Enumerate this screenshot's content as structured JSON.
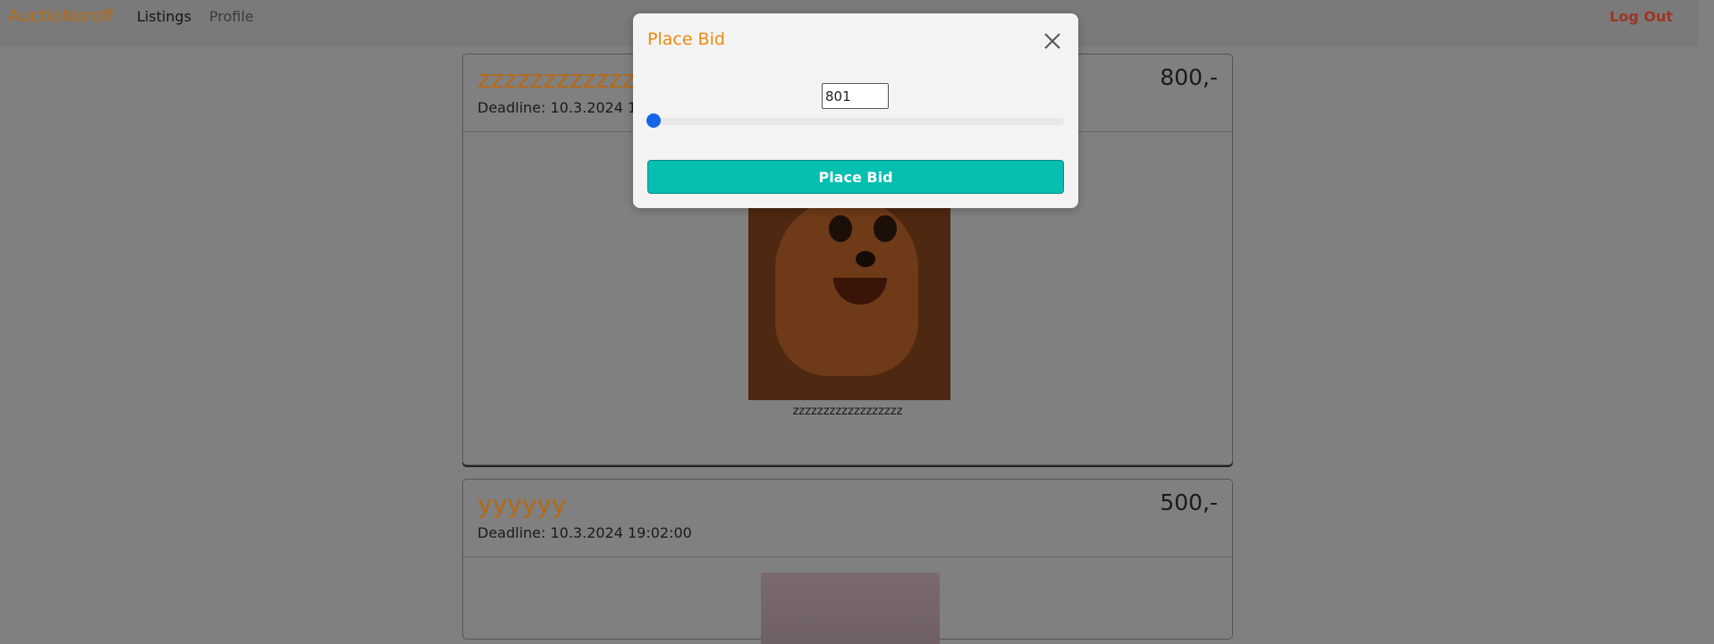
{
  "navbar": {
    "brand": "AuctioNoroff",
    "links": [
      "Listings",
      "Profile"
    ],
    "logout": "Log Out"
  },
  "listings": [
    {
      "title": "zzzzzzzzzzzzzzzzzz",
      "deadline": "Deadline: 10.3.2024 12:",
      "price": "800,-",
      "caption": "zzzzzzzzzzzzzzzzzz"
    },
    {
      "title": "yyyyyy",
      "deadline": "Deadline: 10.3.2024 19:02:00",
      "price": "500,-"
    }
  ],
  "modal": {
    "title": "Place Bid",
    "bid_value": "801",
    "submit_label": "Place Bid"
  },
  "colors": {
    "accent": "#ec8a10",
    "primary_button": "#06bfb0",
    "slider_thumb": "#1565e8",
    "logout": "#dc4b2d"
  }
}
